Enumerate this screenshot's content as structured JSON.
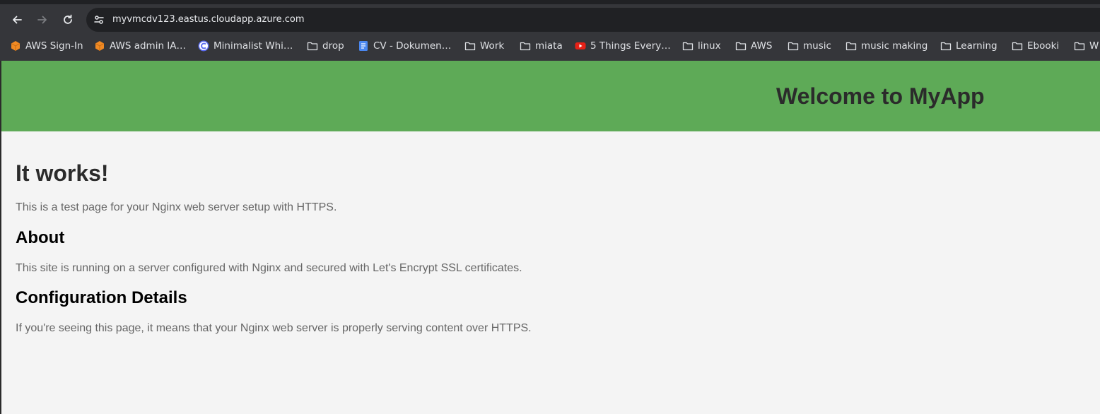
{
  "browser": {
    "url": "myvmcdv123.eastus.cloudapp.azure.com",
    "bookmarks": [
      {
        "label": "AWS Sign-In",
        "icon": "aws-cube-icon"
      },
      {
        "label": "AWS admin IA…",
        "icon": "aws-cube-icon"
      },
      {
        "label": "Minimalist Whi…",
        "icon": "app-logo-icon"
      },
      {
        "label": "drop",
        "icon": "folder-icon"
      },
      {
        "label": "CV - Dokumen…",
        "icon": "docs-icon"
      },
      {
        "label": "Work",
        "icon": "folder-icon"
      },
      {
        "label": "miata",
        "icon": "folder-icon"
      },
      {
        "label": "5 Things Every…",
        "icon": "youtube-icon"
      },
      {
        "label": "linux",
        "icon": "folder-icon"
      },
      {
        "label": "AWS",
        "icon": "folder-icon"
      },
      {
        "label": "music",
        "icon": "folder-icon"
      },
      {
        "label": "music making",
        "icon": "folder-icon"
      },
      {
        "label": "Learning",
        "icon": "folder-icon"
      },
      {
        "label": "Ebooki",
        "icon": "folder-icon"
      },
      {
        "label": "W",
        "icon": "folder-icon"
      }
    ]
  },
  "page": {
    "banner_title": "Welcome to MyApp",
    "heading": "It works!",
    "intro": "This is a test page for your Nginx web server setup with HTTPS.",
    "about_heading": "About",
    "about_text": "This site is running on a server configured with Nginx and secured with Let's Encrypt SSL certificates.",
    "config_heading": "Configuration Details",
    "config_text": "If you're seeing this page, it means that your Nginx web server is properly serving content over HTTPS."
  },
  "colors": {
    "banner": "#5eaa57",
    "chrome": "#35363a",
    "omnibox": "#202124",
    "heading_text": "#2b2b2b",
    "body_text": "#666666"
  }
}
